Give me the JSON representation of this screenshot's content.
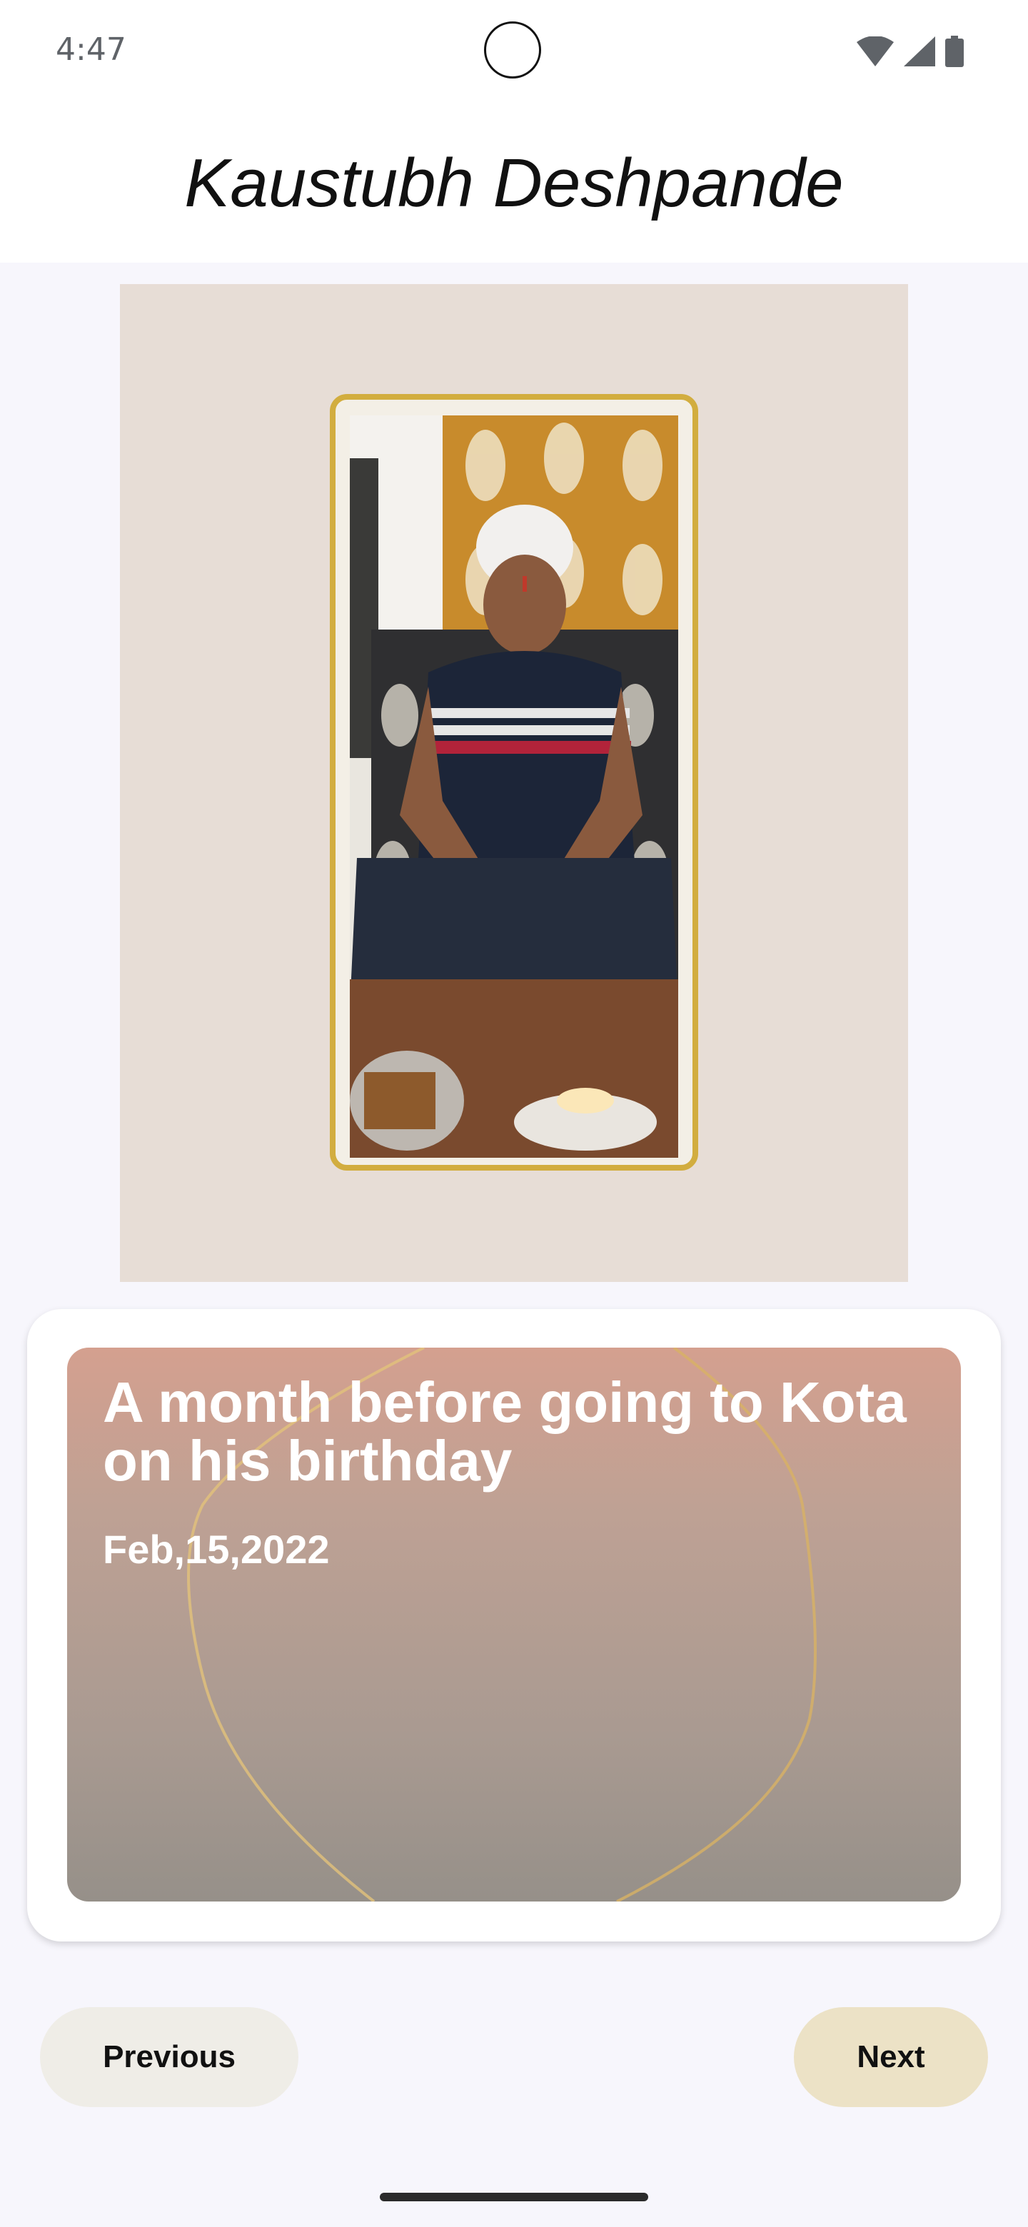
{
  "status_bar": {
    "time": "4:47",
    "icons": [
      "wifi-icon",
      "signal-icon",
      "battery-icon"
    ]
  },
  "header": {
    "title": "Kaustubh Deshpande"
  },
  "photo": {
    "description_icon": "person-photo",
    "frame_color": "#d2ad3f",
    "background_color": "#e7ddd6"
  },
  "caption": {
    "title": "A month before going to Kota on his birthday",
    "date": "Feb,15,2022"
  },
  "navigation": {
    "previous_label": "Previous",
    "next_label": "Next"
  },
  "colors": {
    "accent_gold": "#d2ad3f",
    "next_button": "#ece2c6",
    "previous_button": "#efede7"
  }
}
